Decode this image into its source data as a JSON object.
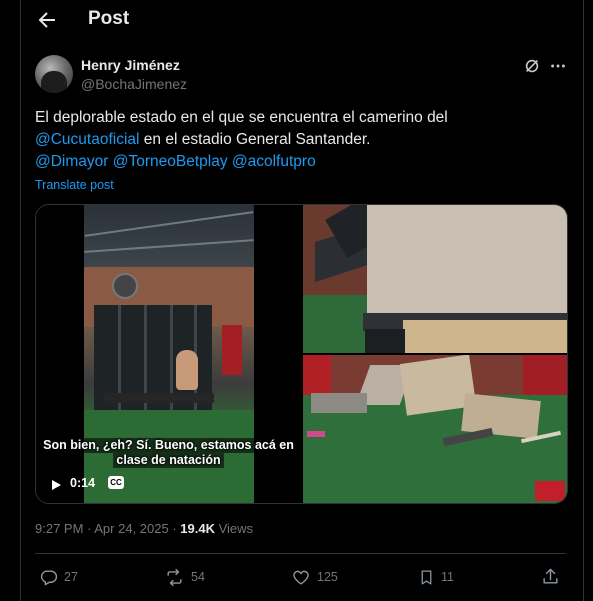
{
  "header": {
    "title": "Post"
  },
  "author": {
    "name": "Henry Jiménez",
    "handle": "@BochaJimenez"
  },
  "tweet": {
    "line1": "El deplorable estado en el que se encuentra el camerino del",
    "mention_cucuta": "@Cucutaoficial",
    "line2_rest": " en el estadio General Santander.",
    "mention_dimayor": "@Dimayor",
    "mention_torneo": "@TorneoBetplay",
    "mention_acolfutpro": "@acolfutpro",
    "translate": "Translate post"
  },
  "video": {
    "caption_line1": "Son bien, ¿eh? Sí. Bueno, estamos acá en",
    "caption_line2": "clase de natación",
    "time": "0:14",
    "cc": "CC"
  },
  "meta": {
    "time": "9:27 PM",
    "dot": " · ",
    "date": "Apr 24, 2025",
    "dot2": " · ",
    "views_count": "19.4K",
    "views_label": " Views"
  },
  "actions": {
    "replies": "27",
    "reposts": "54",
    "likes": "125",
    "bookmarks": "11"
  },
  "colors": {
    "accent": "#1d9bf0",
    "text": "#e7e9ea",
    "muted": "#71767b",
    "border": "#2f3336"
  }
}
